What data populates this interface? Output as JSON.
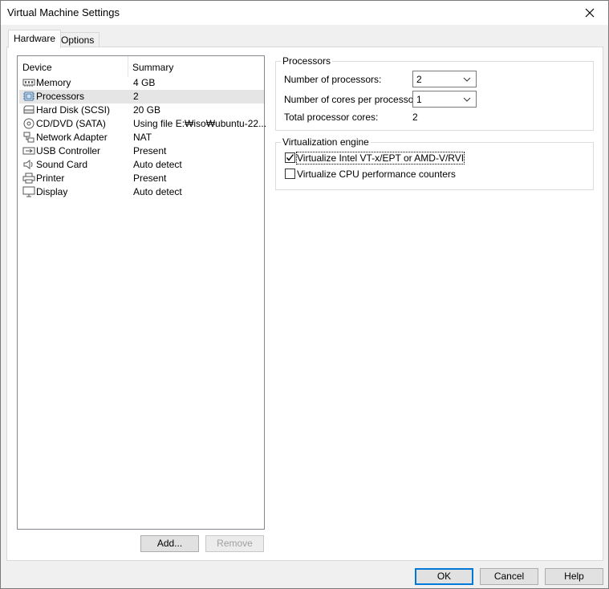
{
  "window": {
    "title": "Virtual Machine Settings"
  },
  "tabs": [
    {
      "label": "Hardware",
      "active": true
    },
    {
      "label": "Options",
      "active": false
    }
  ],
  "device_list": {
    "columns": [
      "Device",
      "Summary"
    ],
    "rows": [
      {
        "device": "Memory",
        "summary": "4 GB",
        "icon": "memory-icon"
      },
      {
        "device": "Processors",
        "summary": "2",
        "icon": "processor-icon",
        "selected": true
      },
      {
        "device": "Hard Disk (SCSI)",
        "summary": "20 GB",
        "icon": "hard-disk-icon"
      },
      {
        "device": "CD/DVD (SATA)",
        "summary": "Using file E:₩iso₩ubuntu-22...",
        "icon": "cd-dvd-icon"
      },
      {
        "device": "Network Adapter",
        "summary": "NAT",
        "icon": "network-adapter-icon"
      },
      {
        "device": "USB Controller",
        "summary": "Present",
        "icon": "usb-icon"
      },
      {
        "device": "Sound Card",
        "summary": "Auto detect",
        "icon": "speaker-icon"
      },
      {
        "device": "Printer",
        "summary": "Present",
        "icon": "printer-icon"
      },
      {
        "device": "Display",
        "summary": "Auto detect",
        "icon": "display-icon"
      }
    ],
    "add_label": "Add...",
    "remove_label": "Remove"
  },
  "processors": {
    "group_title": "Processors",
    "num_processors_label": "Number of processors:",
    "num_processors_value": "2",
    "cores_label": "Number of cores per processor:",
    "cores_value": "1",
    "total_label": "Total processor cores:",
    "total_value": "2"
  },
  "virtualization": {
    "group_title": "Virtualization engine",
    "vtx_label": "Virtualize Intel VT-x/EPT or AMD-V/RVI",
    "vtx_checked": true,
    "perf_label": "Virtualize CPU performance counters",
    "perf_checked": false
  },
  "footer": {
    "ok_label": "OK",
    "cancel_label": "Cancel",
    "help_label": "Help"
  },
  "colors": {
    "selection": "#e5e5e5",
    "focus_blue": "#0078d7"
  }
}
